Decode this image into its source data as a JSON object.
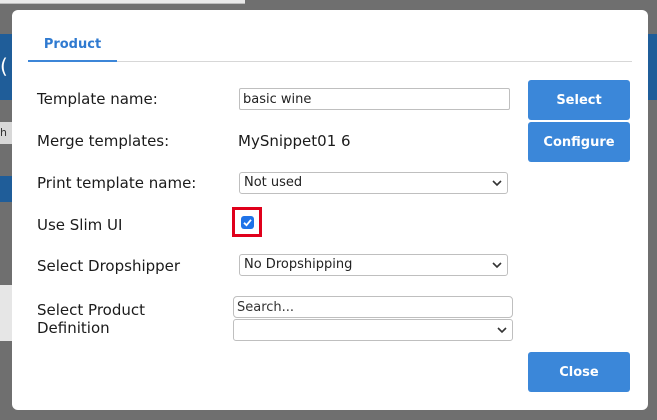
{
  "background": {
    "strip_text": "h",
    "paren": "("
  },
  "tabs": [
    {
      "label": "Product",
      "active": true
    }
  ],
  "form": {
    "template_name": {
      "label": "Template name:",
      "value": "basic wine"
    },
    "merge_templates": {
      "label": "Merge templates:",
      "value": "MySnippet01 6"
    },
    "print_template": {
      "label": "Print template name:",
      "selected": "Not used"
    },
    "slim_ui": {
      "label": "Use Slim UI",
      "checked": true
    },
    "dropshipper": {
      "label": "Select Dropshipper",
      "selected": "No Dropshipping"
    },
    "product_definition": {
      "label_line1": "Select Product",
      "label_line2": "Definition",
      "search_placeholder": "Search...",
      "selected": ""
    }
  },
  "buttons": {
    "select": "Select",
    "configure": "Configure",
    "close": "Close"
  },
  "colors": {
    "accent": "#3b87d9",
    "highlight": "#e0001b",
    "backdrop": "#6f6f6f"
  },
  "icons": {
    "select_arrow": "chevron-down-icon",
    "check": "check-icon"
  }
}
